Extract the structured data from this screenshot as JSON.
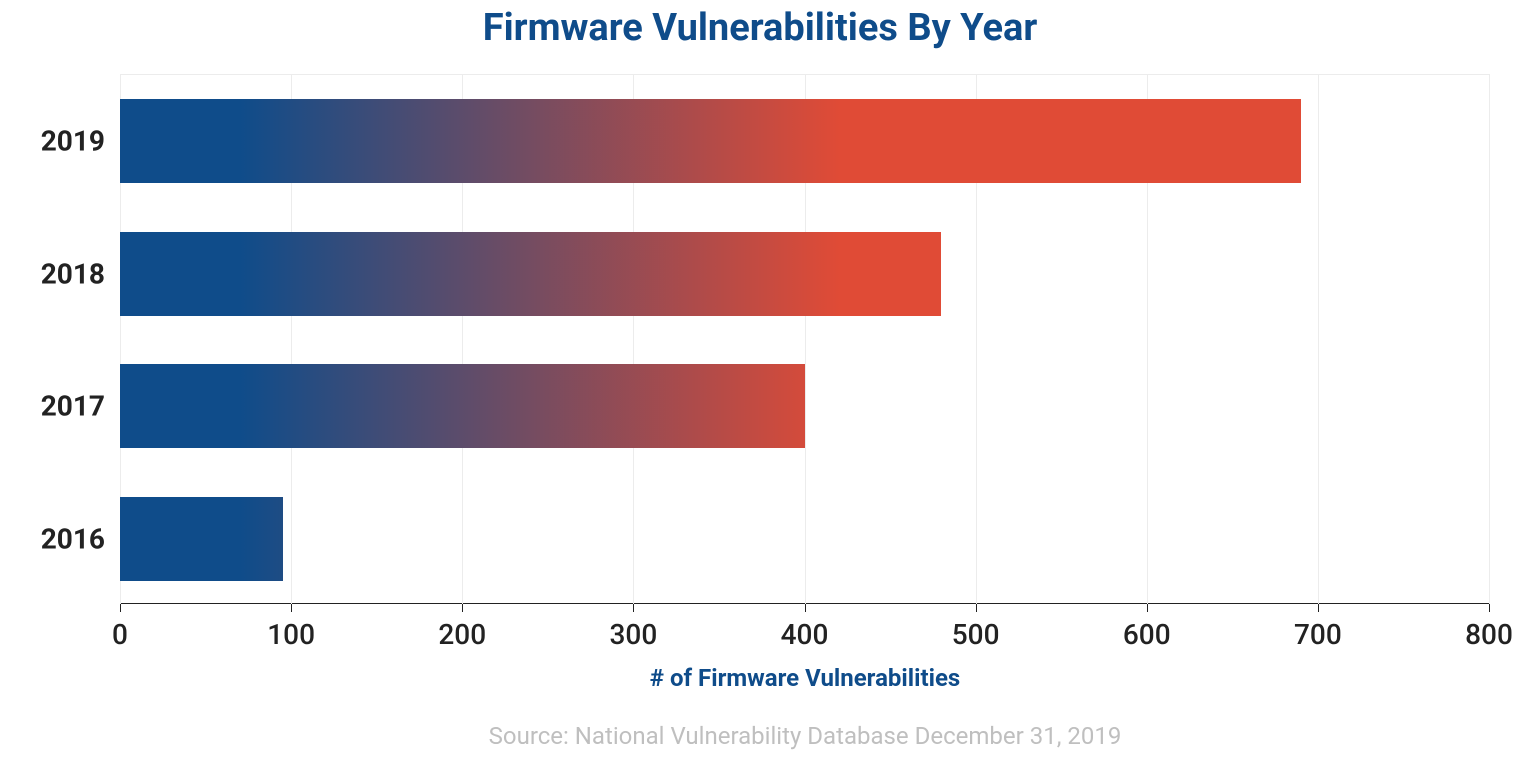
{
  "chart_data": {
    "type": "bar",
    "orientation": "horizontal",
    "title": "Firmware Vulnerabilities By Year",
    "xlabel": "# of Firmware Vulnerabilities",
    "ylabel": "",
    "categories": [
      "2019",
      "2018",
      "2017",
      "2016"
    ],
    "values": [
      690,
      480,
      400,
      95
    ],
    "xlim": [
      0,
      800
    ],
    "x_ticks": [
      0,
      100,
      200,
      300,
      400,
      500,
      600,
      700,
      800
    ],
    "grid_x": true,
    "bar_fill": "gradient #0f4c8a -> #e04b36",
    "source": "Source: National Vulnerability Database December 31, 2019"
  }
}
